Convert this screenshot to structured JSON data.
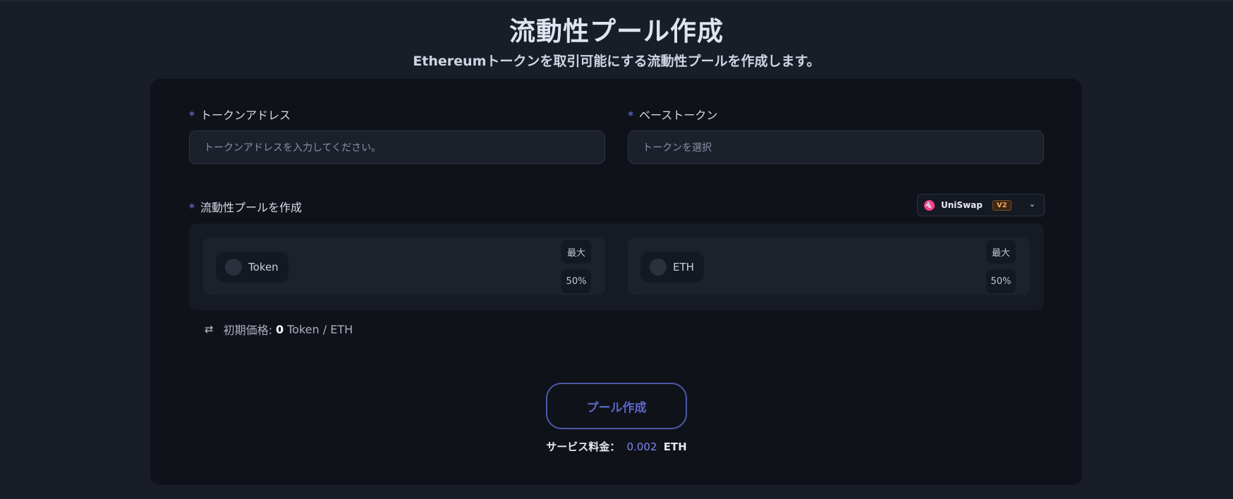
{
  "header": {
    "title": "流動性プール作成",
    "subtitle": "Ethereumトークンを取引可能にする流動性プールを作成します。"
  },
  "form": {
    "required_mark": "*",
    "token_address": {
      "label": "トークンアドレス",
      "placeholder": "トークンアドレスを入力してください。"
    },
    "base_token": {
      "label": "ベーストークン",
      "placeholder": "トークンを選択"
    },
    "pool": {
      "label": "流動性プールを作成",
      "dex": {
        "name": "UniSwap",
        "version": "V2",
        "icon": "uniswap-logo-icon"
      },
      "left_token": {
        "symbol": "Token",
        "max_label": "最大",
        "half_label": "50%"
      },
      "right_token": {
        "symbol": "ETH",
        "max_label": "最大",
        "half_label": "50%"
      }
    },
    "initial_price": {
      "label": "初期価格:",
      "value": "0",
      "unit": "Token / ETH"
    }
  },
  "actions": {
    "create_label": "プール作成"
  },
  "fee": {
    "label": "サービス料金：",
    "amount": "0.002",
    "unit": "ETH"
  },
  "colors": {
    "background": "#191d27",
    "card": "#10121a",
    "accent": "#6f7cf0",
    "button_border": "#4c58a8",
    "badge": "#f2a65a"
  }
}
